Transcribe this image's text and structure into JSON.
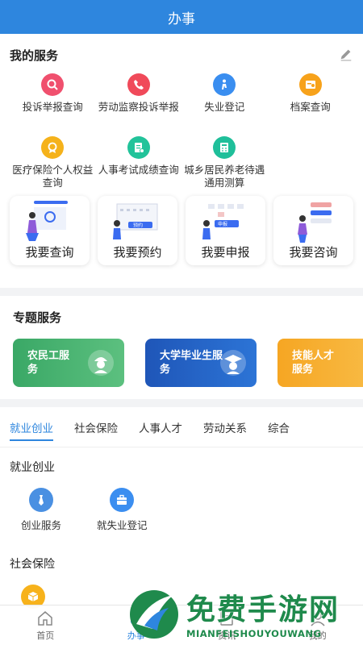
{
  "header": {
    "title": "办事"
  },
  "my_services": {
    "title": "我的服务",
    "items": [
      {
        "label": "投诉举报查询",
        "icon": "search-report-icon",
        "color": "#f0506e"
      },
      {
        "label": "劳动监察投诉举报",
        "icon": "phone-icon",
        "color": "#f04a5a"
      },
      {
        "label": "失业登记",
        "icon": "person-walk-icon",
        "color": "#3a8ef0"
      },
      {
        "label": "档案查询",
        "icon": "archive-icon",
        "color": "#f7a21b"
      },
      {
        "label": "医疗保险个人权益查询",
        "icon": "medical-badge-icon",
        "color": "#f5b21b"
      },
      {
        "label": "人事考试成绩查询",
        "icon": "exam-doc-icon",
        "color": "#22c39a"
      },
      {
        "label": "城乡居民养老待遇通用测算",
        "icon": "calculator-icon",
        "color": "#1fbf9a"
      }
    ],
    "quick": [
      {
        "label": "我要查询"
      },
      {
        "label": "我要预约",
        "tag": "预约"
      },
      {
        "label": "我要申报",
        "tag": "申报"
      },
      {
        "label": "我要咨询"
      }
    ]
  },
  "topics": {
    "title": "专题服务",
    "cards": [
      {
        "label": "农民工服务",
        "color": "#3aa866"
      },
      {
        "label": "大学毕业生服务",
        "color": "#1f56b8"
      },
      {
        "label": "技能人才服务",
        "color": "#f6a623"
      }
    ]
  },
  "tabs": [
    {
      "label": "就业创业",
      "active": true
    },
    {
      "label": "社会保险",
      "active": false
    },
    {
      "label": "人事人才",
      "active": false
    },
    {
      "label": "劳动关系",
      "active": false
    },
    {
      "label": "综合",
      "active": false
    }
  ],
  "sections": [
    {
      "title": "就业创业",
      "items": [
        {
          "label": "创业服务",
          "icon": "tie-icon",
          "color": "#4a90e2"
        },
        {
          "label": "就失业登记",
          "icon": "briefcase-icon",
          "color": "#3b8ef0"
        }
      ]
    },
    {
      "title": "社会保险",
      "items": [
        {
          "label": "",
          "icon": "box-icon",
          "color": "#f7b21b"
        }
      ]
    }
  ],
  "tabbar": [
    {
      "label": "首页",
      "icon": "home-icon"
    },
    {
      "label": "办事",
      "icon": "service-icon",
      "active": true
    },
    {
      "label": "资讯",
      "icon": "news-icon"
    },
    {
      "label": "我的",
      "icon": "user-icon"
    }
  ],
  "watermark": {
    "cn": "免费手游网",
    "en": "MIANFEISHOUYOUWANG"
  }
}
